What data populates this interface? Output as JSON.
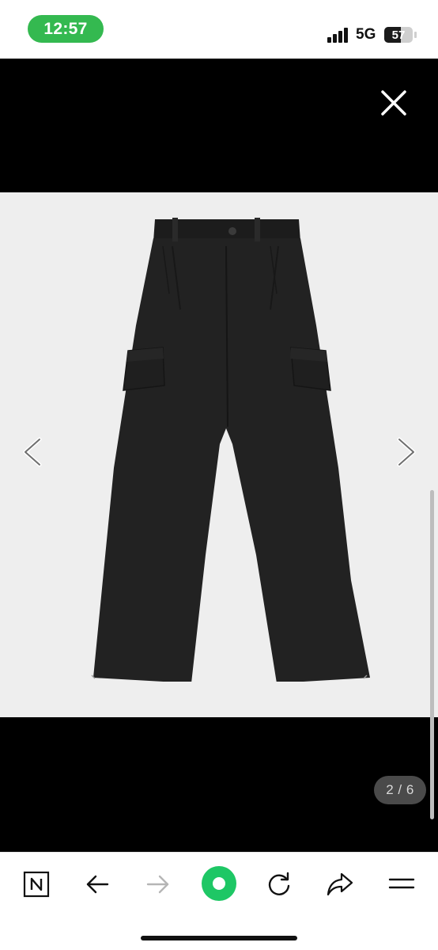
{
  "status_bar": {
    "time": "12:57",
    "network": "5G",
    "battery_level": "57",
    "time_pill_color": "#34b950"
  },
  "viewer": {
    "close_icon": "close-icon",
    "prev_icon": "chevron-left-icon",
    "next_icon": "chevron-right-icon",
    "image_subject": "black wide-leg cargo pants",
    "counter": "2 / 6",
    "current_index": 2,
    "total": 6
  },
  "toolbar": {
    "items": [
      {
        "name": "naver-home",
        "icon": "naver-n-icon"
      },
      {
        "name": "back",
        "icon": "arrow-left-icon"
      },
      {
        "name": "forward",
        "icon": "arrow-right-icon",
        "disabled": true
      },
      {
        "name": "green-dot",
        "icon": "green-dot-icon",
        "color": "#1ec765"
      },
      {
        "name": "refresh",
        "icon": "refresh-icon"
      },
      {
        "name": "share",
        "icon": "share-icon"
      },
      {
        "name": "menu",
        "icon": "menu-icon"
      }
    ]
  }
}
